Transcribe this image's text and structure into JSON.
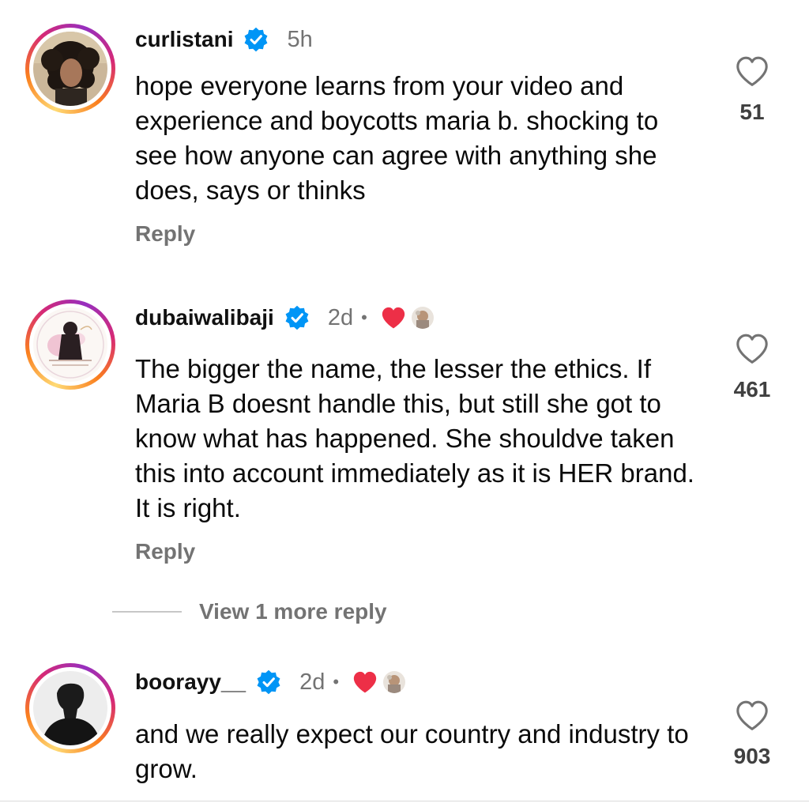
{
  "comments": [
    {
      "username": "curlistani",
      "time": "5h",
      "text": "hope everyone learns from your video and experience and boycotts maria b. shocking to see how anyone can agree with anything she does, says or thinks",
      "reply_label": "Reply",
      "likes": "51",
      "verified": true,
      "liked_by_creator": false
    },
    {
      "username": "dubaiwalibaji",
      "time": "2d",
      "separator": "•",
      "text": "The bigger the name, the lesser the ethics. If Maria B doesnt handle this, but still she got to know what has happened. She shouldve taken this into account immediately as it is HER brand. It is right.",
      "reply_label": "Reply",
      "likes": "461",
      "verified": true,
      "liked_by_creator": true
    },
    {
      "username": "boorayy__",
      "time": "2d",
      "separator": "•",
      "text": "and we really expect our country and industry to grow.",
      "likes": "903",
      "verified": true,
      "liked_by_creator": true
    }
  ],
  "view_more_replies": "View 1 more reply",
  "icons": {
    "verified": "verified-badge-icon",
    "like": "heart-outline-icon",
    "creator_like": "red-heart-icon"
  },
  "colors": {
    "verified_blue": "#0095f6",
    "heart_red": "#ed2f47",
    "secondary_text": "#737373"
  }
}
